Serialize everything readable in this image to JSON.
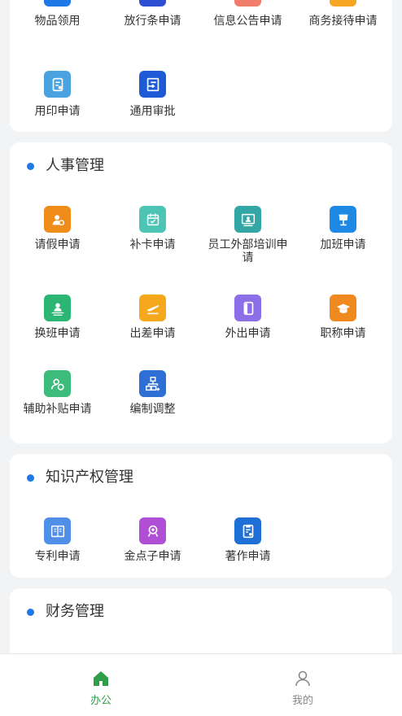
{
  "sections": [
    {
      "title": "",
      "items": [
        {
          "label": "物品领用",
          "icon": "box-out-icon",
          "color": "#1e78e6"
        },
        {
          "label": "放行条申请",
          "icon": "pass-slip-icon",
          "color": "#2c4fd1"
        },
        {
          "label": "信息公告申请",
          "icon": "notice-icon",
          "color": "#f07c6c"
        },
        {
          "label": "商务接待申请",
          "icon": "reception-icon",
          "color": "#f5a623"
        },
        {
          "label": "用印申请",
          "icon": "seal-icon",
          "color": "#4aa3df"
        },
        {
          "label": "通用审批",
          "icon": "approval-icon",
          "color": "#1e5ad6"
        }
      ]
    },
    {
      "title": "人事管理",
      "items": [
        {
          "label": "请假申请",
          "icon": "leave-icon",
          "color": "#f08c1a"
        },
        {
          "label": "补卡申请",
          "icon": "calendar-check-icon",
          "color": "#4cc5b5"
        },
        {
          "label": "员工外部培训申请",
          "icon": "training-icon",
          "color": "#35a6a6"
        },
        {
          "label": "加班申请",
          "icon": "overtime-lamp-icon",
          "color": "#1e88e5"
        },
        {
          "label": "换班申请",
          "icon": "shift-swap-icon",
          "color": "#2bb673"
        },
        {
          "label": "出差申请",
          "icon": "plane-icon",
          "color": "#f5a81c"
        },
        {
          "label": "外出申请",
          "icon": "door-out-icon",
          "color": "#8b6ee8"
        },
        {
          "label": "职称申请",
          "icon": "graduation-cap-icon",
          "color": "#f08a1e"
        },
        {
          "label": "辅助补贴申请",
          "icon": "subsidy-icon",
          "color": "#3dbb7a"
        },
        {
          "label": "编制调整",
          "icon": "org-chart-icon",
          "color": "#2e6fd6"
        }
      ]
    },
    {
      "title": "知识产权管理",
      "items": [
        {
          "label": "专利申请",
          "icon": "patent-book-icon",
          "color": "#4f8fe8"
        },
        {
          "label": "金点子申请",
          "icon": "idea-icon",
          "color": "#b04fd6"
        },
        {
          "label": "著作申请",
          "icon": "copyright-doc-icon",
          "color": "#1e6fd6"
        }
      ]
    },
    {
      "title": "财务管理",
      "items": []
    }
  ],
  "tabbar": {
    "tabs": [
      {
        "label": "办公",
        "icon": "home-icon",
        "active": true
      },
      {
        "label": "我的",
        "icon": "user-icon",
        "active": false
      }
    ],
    "active_color": "#2e9e4a",
    "inactive_color": "#888888"
  }
}
